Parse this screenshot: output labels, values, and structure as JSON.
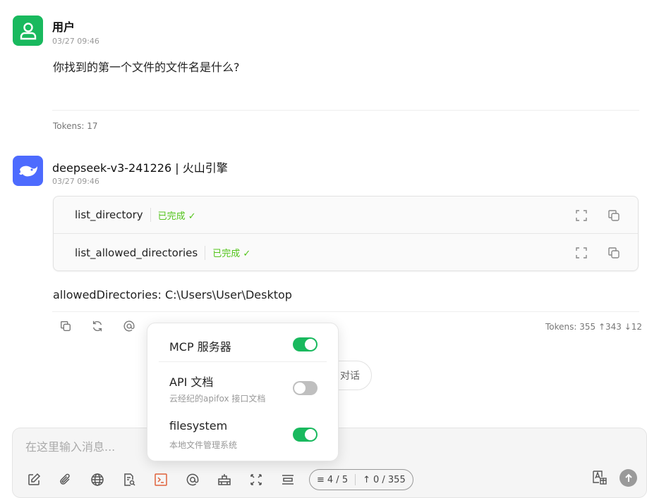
{
  "messages": {
    "user": {
      "name": "用户",
      "time": "03/27 09:46",
      "text": "你找到的第一个文件的文件名是什么?",
      "tokens": "Tokens: 17"
    },
    "assistant": {
      "name": "deepseek-v3-241226 | 火山引擎",
      "time": "03/27 09:46",
      "tool_calls": [
        {
          "name": "list_directory",
          "status": "已完成 ✓"
        },
        {
          "name": "list_allowed_directories",
          "status": "已完成 ✓"
        }
      ],
      "text": "allowedDirectories: C:\\Users\\User\\Desktop",
      "tokens": "Tokens: 355 ↑343 ↓12"
    }
  },
  "new_chat_label": "对话",
  "input": {
    "placeholder": "在这里输入消息...",
    "value": ""
  },
  "counter": {
    "context": "4 / 5",
    "tokens": "0 / 355"
  },
  "mcp_popover": {
    "items": [
      {
        "title": "MCP 服务器",
        "subtitle": "",
        "enabled": true
      },
      {
        "title": "API 文档",
        "subtitle": "云经纪的apifox 接口文档",
        "enabled": false
      },
      {
        "title": "filesystem",
        "subtitle": "本地文件管理系统",
        "enabled": true
      }
    ]
  },
  "colors": {
    "user_avatar": "#19b95e",
    "bot_avatar": "#4d6bfe",
    "status_done": "#52c41a",
    "toggle_on": "#19b95e",
    "toggle_off": "#bfbfbf",
    "active_tool": "#e0623b"
  }
}
